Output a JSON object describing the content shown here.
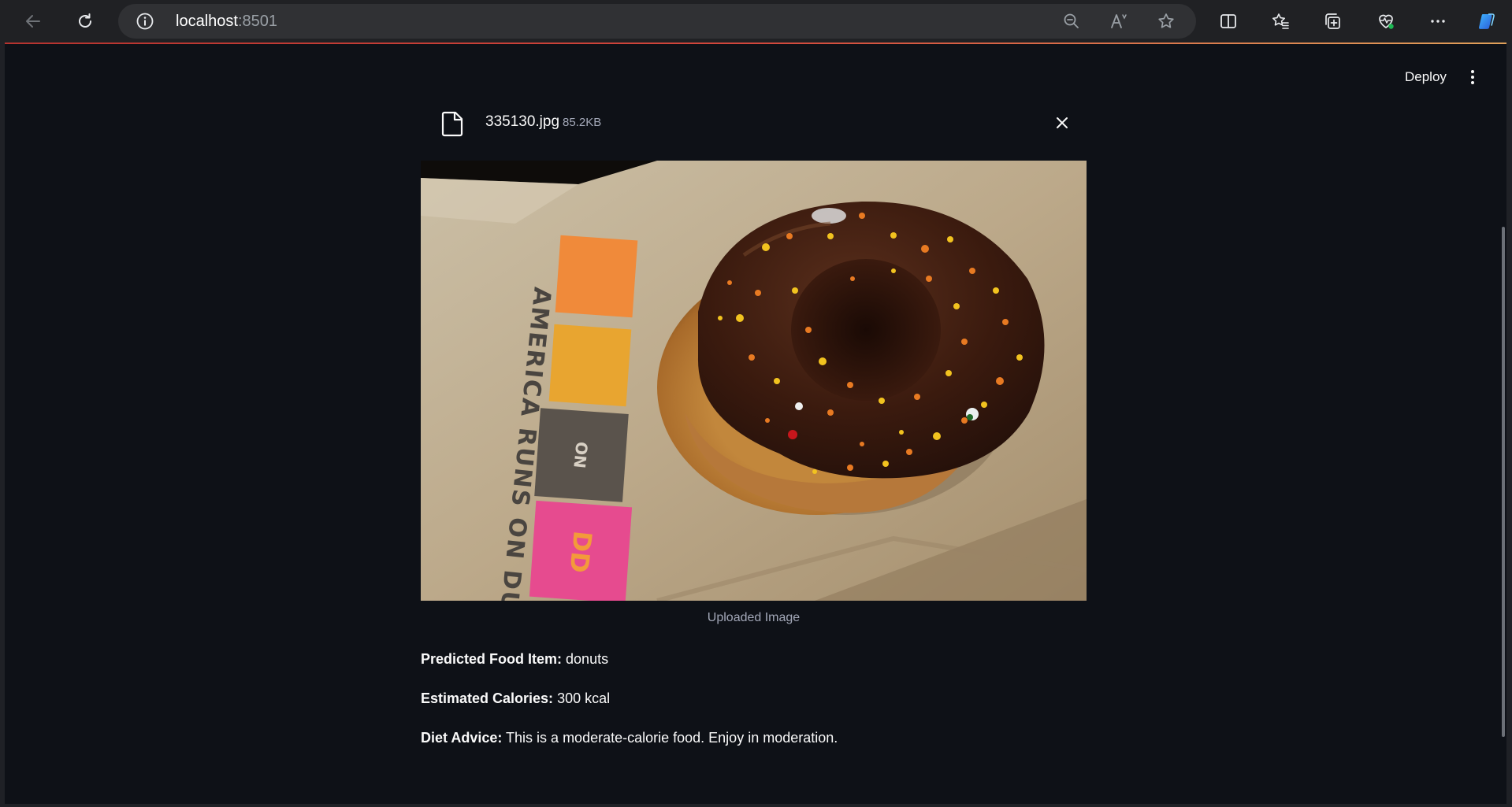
{
  "browser": {
    "url_host": "localhost",
    "url_port": ":8501"
  },
  "toolbar": {
    "deploy_label": "Deploy"
  },
  "uploader": {
    "file_name": "335130.jpg",
    "file_size": "85.2KB"
  },
  "image": {
    "caption": "Uploaded Image",
    "bag_text": "AMERICA RUNS ON DUNKIN'",
    "bag_badge": "ON",
    "bag_logo": "DD"
  },
  "results": {
    "food_label": "Predicted Food Item:",
    "food_value": "donuts",
    "calories_label": "Estimated Calories:",
    "calories_value": "300 kcal",
    "advice_label": "Diet Advice:",
    "advice_value": "This is a moderate-calorie food. Enjoy in moderation."
  },
  "colors": {
    "app_background": "#0e1117",
    "chrome_background": "#202124",
    "text_primary": "#fafafa",
    "text_muted": "#a3a8b8",
    "accent_bar": "#d2473c"
  }
}
